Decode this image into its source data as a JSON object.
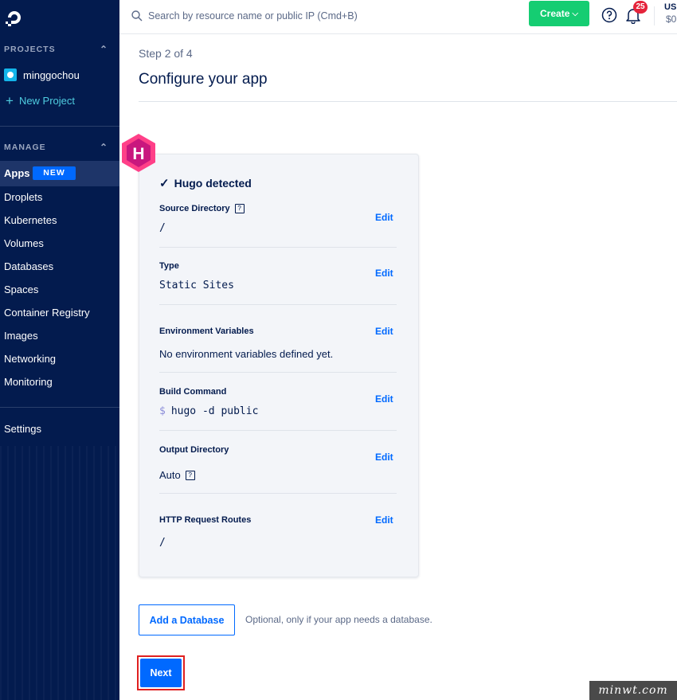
{
  "sidebar": {
    "projects_heading": "PROJECTS",
    "project_name": "minggochou",
    "new_project_label": "New Project",
    "manage_heading": "MANAGE",
    "apps_label": "Apps",
    "apps_badge": "NEW",
    "items": [
      "Droplets",
      "Kubernetes",
      "Volumes",
      "Databases",
      "Spaces",
      "Container Registry",
      "Images",
      "Networking",
      "Monitoring"
    ],
    "settings_label": "Settings"
  },
  "topbar": {
    "search_placeholder": "Search by resource name or public IP (Cmd+B)",
    "create_label": "Create",
    "notification_count": "25",
    "usage_label": "US",
    "usage_value": "$0"
  },
  "main": {
    "step": "Step 2 of 4",
    "title": "Configure your app",
    "detected": "Hugo detected",
    "hugo_logo_letter": "H",
    "fields": [
      {
        "label": "Source Directory",
        "value": "/",
        "edit": "Edit"
      },
      {
        "label": "Type",
        "value": "Static Sites",
        "edit": "Edit"
      },
      {
        "label": "Environment Variables",
        "value": "No environment variables defined yet.",
        "edit": "Edit"
      },
      {
        "label": "Build Command",
        "prompt": "$",
        "value": "hugo -d public",
        "edit": "Edit"
      },
      {
        "label": "Output Directory",
        "value": "Auto",
        "edit": "Edit"
      },
      {
        "label": "HTTP Request Routes",
        "value": "/",
        "edit": "Edit"
      }
    ],
    "help_mark": "?",
    "add_database_label": "Add a Database",
    "add_database_hint": "Optional, only if your app needs a database.",
    "next_label": "Next"
  },
  "watermark": "minwt.com",
  "colors": {
    "sidebar_bg": "#031b4e",
    "accent": "#0069ff",
    "create_green": "#15cd72",
    "badge_red": "#e5243b",
    "hugo_pink": "#ff4088",
    "highlight_red": "#e02020"
  },
  "icons": [
    "digitalocean-logo-icon",
    "chevron-up-icon",
    "plus-icon",
    "search-icon",
    "chevron-down-icon",
    "help-icon",
    "bell-icon",
    "check-icon",
    "hugo-logo-icon",
    "question-mark-icon"
  ]
}
